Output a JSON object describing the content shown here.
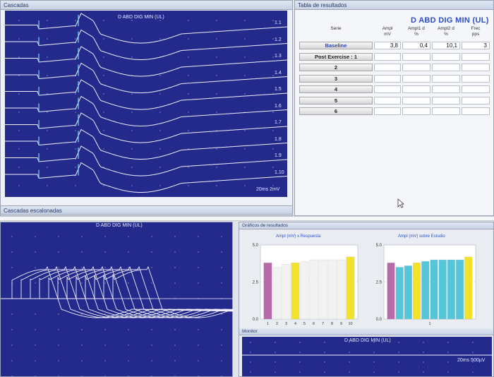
{
  "cascadas": {
    "panel_title": "Cascadas",
    "trace_title": "D ABD DIG MIN (UL)",
    "trace_labels": [
      "1.1",
      "1.2",
      "1.3",
      "1.4",
      "1.5",
      "1.6",
      "1.7",
      "1.8",
      "1.9",
      "1.10"
    ],
    "scale": "20ms 2mV"
  },
  "escalonadas": {
    "panel_title": "Cascadas escalonadas",
    "trace_title": "D ABD DIG MIN (UL)"
  },
  "tabla": {
    "panel_title": "Tabla de resultados",
    "title": "D ABD DIG MIN (UL)",
    "headers": [
      "Serie",
      "Ampl\nmV",
      "Ampl1 d\n%",
      "Ampl2 d\n%",
      "Frec\npps"
    ],
    "rows": [
      {
        "label": "Baseline",
        "values": [
          "3,8",
          "0,4",
          "10,1",
          "3"
        ]
      },
      {
        "label": "Post Exercise : 1",
        "values": [
          "",
          "",
          "",
          ""
        ]
      },
      {
        "label": "2",
        "values": [
          "",
          "",
          "",
          ""
        ]
      },
      {
        "label": "3",
        "values": [
          "",
          "",
          "",
          ""
        ]
      },
      {
        "label": "4",
        "values": [
          "",
          "",
          "",
          ""
        ]
      },
      {
        "label": "5",
        "values": [
          "",
          "",
          "",
          ""
        ]
      },
      {
        "label": "6",
        "values": [
          "",
          "",
          "",
          ""
        ]
      }
    ]
  },
  "graficos": {
    "panel_title": "Gráficos de resultados"
  },
  "monitor": {
    "panel_title": "Monitor",
    "trace_title": "D ABD DIG MIN (UL)",
    "scale": "20ms 500µV"
  },
  "colors": {
    "trace_bg": "#232a8c",
    "purple": "#b66aa9",
    "white": "#f2f2f2",
    "yellow": "#f2e32a",
    "cyan": "#55c5d9"
  },
  "chart_data": [
    {
      "type": "bar",
      "title": "Ampl (mV) x Respuesta",
      "categories": [
        "1",
        "2",
        "3",
        "4",
        "5",
        "6",
        "7",
        "8",
        "9",
        "10"
      ],
      "values": [
        3.8,
        3.5,
        3.7,
        3.8,
        3.9,
        4.0,
        4.0,
        4.0,
        4.0,
        4.2
      ],
      "colors": [
        "#b66aa9",
        "#f2f2f2",
        "#f2f2f2",
        "#f2e32a",
        "#f2f2f2",
        "#f2f2f2",
        "#f2f2f2",
        "#f2f2f2",
        "#f2f2f2",
        "#f2e32a"
      ],
      "yticks": [
        "0.0",
        "2.5",
        "5.0"
      ],
      "ylim": [
        0,
        5
      ],
      "grid": true
    },
    {
      "type": "bar",
      "title": "Ampl (mV) sobre Estudio",
      "categories": [
        "1"
      ],
      "values": [
        3.8,
        3.5,
        3.6,
        3.8,
        3.9,
        4.0,
        4.0,
        4.0,
        4.0,
        4.2
      ],
      "colors": [
        "#b66aa9",
        "#55c5d9",
        "#55c5d9",
        "#f2e32a",
        "#55c5d9",
        "#55c5d9",
        "#55c5d9",
        "#55c5d9",
        "#55c5d9",
        "#f2e32a"
      ],
      "yticks": [
        "0.0",
        "2.5",
        "5.0"
      ],
      "ylim": [
        0,
        5
      ],
      "grid": true
    }
  ]
}
